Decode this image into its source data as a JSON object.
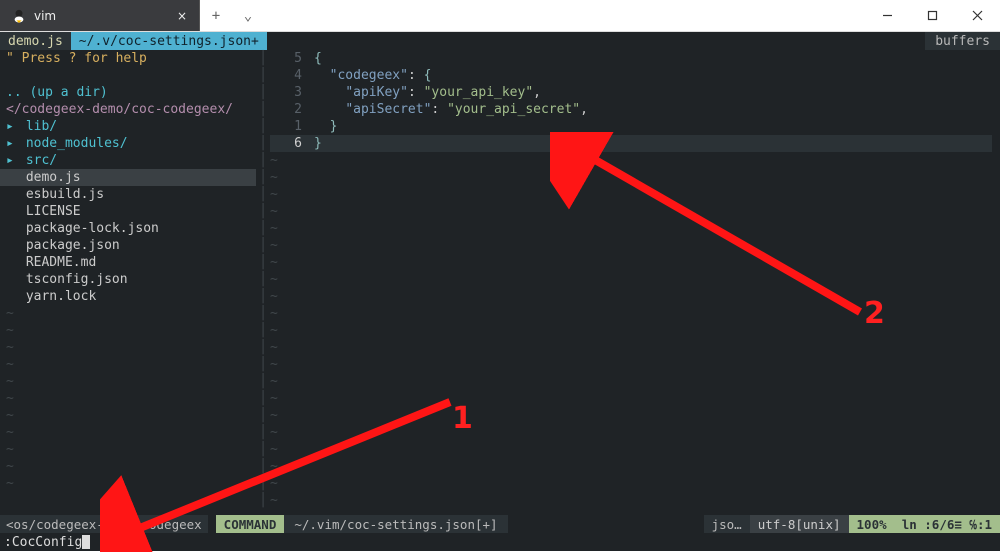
{
  "window": {
    "tab_title": "vim",
    "tab_close": "×",
    "newtab": "+",
    "chev": "⌄"
  },
  "tabline": {
    "a": "demo.js",
    "b": "~/.v/coc-settings.json+",
    "right": "buffers"
  },
  "sidebar": {
    "help": "\" Press ? for help",
    "up": ".. (up a dir)",
    "path": "</codegeex-demo/coc-codegeex/",
    "items": [
      {
        "arrow": "▸",
        "label": "lib/",
        "cls": "blue"
      },
      {
        "arrow": "▸",
        "label": "node_modules/",
        "cls": "blue"
      },
      {
        "arrow": "▸",
        "label": "src/",
        "cls": "blue"
      },
      {
        "arrow": " ",
        "label": "demo.js",
        "cls": "",
        "sel": true
      },
      {
        "arrow": " ",
        "label": "esbuild.js",
        "cls": ""
      },
      {
        "arrow": " ",
        "label": "LICENSE",
        "cls": ""
      },
      {
        "arrow": " ",
        "label": "package-lock.json",
        "cls": ""
      },
      {
        "arrow": " ",
        "label": "package.json",
        "cls": ""
      },
      {
        "arrow": " ",
        "label": "README.md",
        "cls": ""
      },
      {
        "arrow": " ",
        "label": "tsconfig.json",
        "cls": ""
      },
      {
        "arrow": " ",
        "label": "yarn.lock",
        "cls": ""
      }
    ]
  },
  "editor": {
    "gutter": [
      "5",
      "4",
      "3",
      "2",
      "1",
      "6"
    ],
    "current_line": 5,
    "lines": [
      {
        "indent": "",
        "type": "brace",
        "text": "{"
      },
      {
        "indent": "  ",
        "type": "kv",
        "key": "\"codegeex\"",
        "sep": ": ",
        "val": "{"
      },
      {
        "indent": "    ",
        "type": "kv",
        "key": "\"apiKey\"",
        "sep": ": ",
        "val": "\"your_api_key\"",
        "comma": ","
      },
      {
        "indent": "    ",
        "type": "kv",
        "key": "\"apiSecret\"",
        "sep": ": ",
        "val": "\"your_api_secret\"",
        "comma": ","
      },
      {
        "indent": "  ",
        "type": "brace",
        "text": "}"
      },
      {
        "indent": "",
        "type": "brace",
        "text": "}"
      }
    ]
  },
  "status": {
    "left": "<os/codegeex-dem      -codegeex",
    "mode": "COMMAND",
    "path": "~/.vim/coc-settings.json[+]",
    "right1": "jso…",
    "right2": "utf-8[unix]",
    "right3a": "100%",
    "right3b": "ln :6/6≡ ℅:1"
  },
  "cmdline": {
    "text": ":CocConfig"
  },
  "annotations": {
    "n1": "1",
    "n2": "2"
  }
}
